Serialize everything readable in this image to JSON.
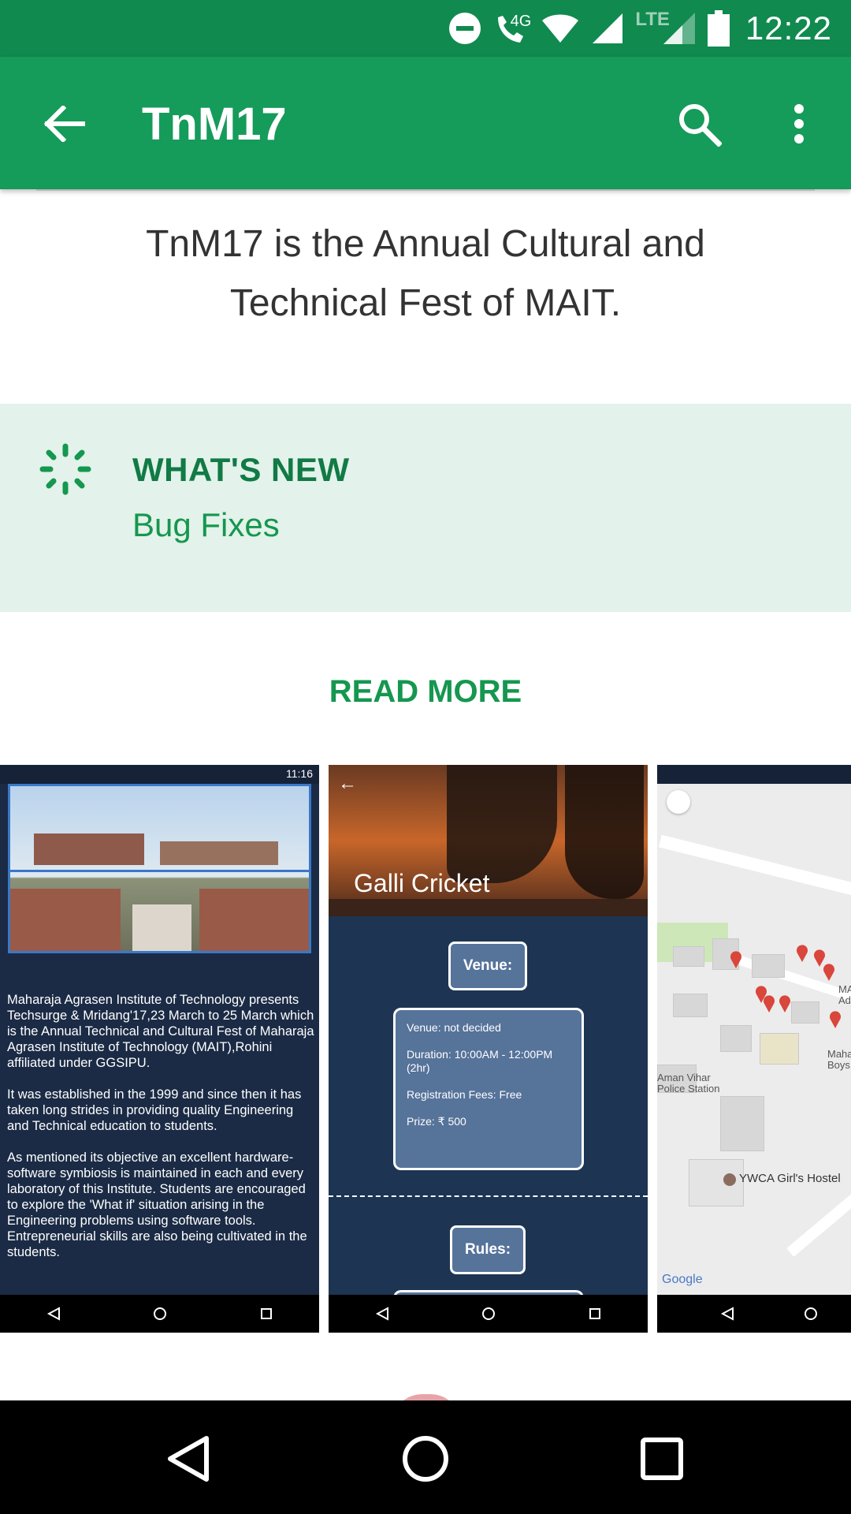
{
  "status_bar": {
    "time": "12:22",
    "network_label": "4G",
    "lte_label": "LTE"
  },
  "app_bar": {
    "title": "TnM17"
  },
  "description": "TnM17 is the Annual Cultural and Technical Fest of MAIT.",
  "whats_new": {
    "title": "WHAT'S NEW",
    "text": "Bug Fixes"
  },
  "read_more_label": "READ MORE",
  "screenshots": {
    "shot1": {
      "time": "11:16",
      "paragraphs": [
        "Maharaja Agrasen Institute of Technology presents Techsurge & Mridang'17,23 March to 25 March which is the Annual Technical and Cultural Fest of Maharaja Agrasen Institute of Technology (MAIT),Rohini affiliated under GGSIPU.",
        "It was established in the 1999 and since then it has taken long strides in providing quality Engineering and Technical education to students.",
        "As mentioned its objective an excellent hardware-software symbiosis is maintained in each and every laboratory of this Institute. Students are encouraged to explore the 'What if' situation arising in the Engineering problems using software tools. Entrepreneurial skills are also being cultivated in the students."
      ]
    },
    "shot2": {
      "title": "Galli Cricket",
      "venue_label": "Venue:",
      "venue": "Venue: not decided",
      "duration": "Duration: 10:00AM - 12:00PM (2hr)",
      "fees": "Registration Fees: Free",
      "prize": "Prize: ₹ 500",
      "rules_label": "Rules:"
    },
    "shot3": {
      "label_police": "Aman Vihar Police Station",
      "label_hostel": "YWCA Girl's Hostel",
      "label_ma": "MA Ad",
      "label_maha": "Maha Boys",
      "google": "Google"
    }
  },
  "colors": {
    "status_bar": "#108a4f",
    "app_bar": "#159b5a",
    "accent": "#15974f",
    "whats_new_bg": "#e3f2ea"
  }
}
